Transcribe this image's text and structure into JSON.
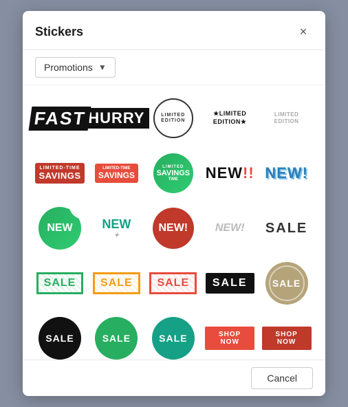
{
  "modal": {
    "title": "Stickers",
    "dropdown_label": "Promotions",
    "cancel_label": "Cancel",
    "close_label": "×"
  },
  "stickers": [
    {
      "id": "fast",
      "label": "FAST"
    },
    {
      "id": "hurry",
      "label": "HURRY"
    },
    {
      "id": "limited-edition-circle",
      "label": "LIMITED EDITION"
    },
    {
      "id": "limited-edition-star",
      "label": "*LIMITED EDITION*"
    },
    {
      "id": "limited-edition-faded",
      "label": "LIMITED EDITION"
    },
    {
      "id": "limited-time-savings-red",
      "label": "LIMITED-TIME SAVINGS"
    },
    {
      "id": "limited-time-savings-ribbon",
      "label": "LIMITED-TIME SAVINGS"
    },
    {
      "id": "limited-savings-circle",
      "label": "LIMITED SAVINGS TIME"
    },
    {
      "id": "new-black",
      "label": "NEW!"
    },
    {
      "id": "new-blue",
      "label": "NEW!"
    },
    {
      "id": "new-green-circle",
      "label": "NEW"
    },
    {
      "id": "new-teal-text",
      "label": "NEW"
    },
    {
      "id": "new-circle-red",
      "label": "NEW!"
    },
    {
      "id": "new-gray",
      "label": "NEW!"
    },
    {
      "id": "sale-plain",
      "label": "SALE"
    },
    {
      "id": "sale-green-border",
      "label": "SALE"
    },
    {
      "id": "sale-yellow-border",
      "label": "SALE"
    },
    {
      "id": "sale-red-border",
      "label": "SALE"
    },
    {
      "id": "sale-black-fill",
      "label": "SALE"
    },
    {
      "id": "sale-tan-badge",
      "label": "SALE"
    },
    {
      "id": "sale-black-circle",
      "label": "SALE"
    },
    {
      "id": "sale-green-circle",
      "label": "SALE"
    },
    {
      "id": "sale-teal-circle",
      "label": "SALE"
    },
    {
      "id": "shop-now-red",
      "label": "SHOP NOW"
    },
    {
      "id": "shop-now-dark",
      "label": "SHOP NOW"
    }
  ]
}
